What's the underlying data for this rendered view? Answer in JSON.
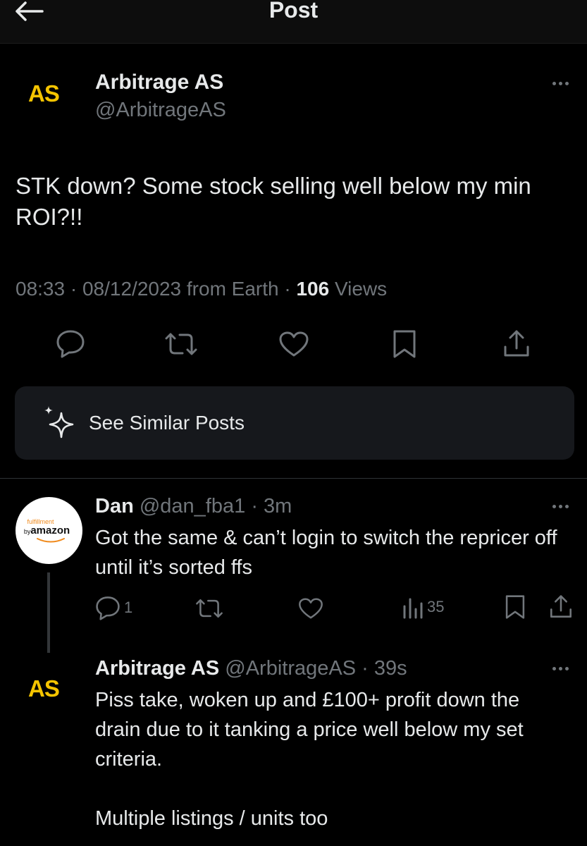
{
  "header": {
    "title": "Post"
  },
  "post": {
    "avatar_text": "AS",
    "author_name": "Arbitrage AS",
    "author_handle": "@ArbitrageAS",
    "text": "STK down? Some stock selling well below my min ROI?!!",
    "time": "08:33",
    "date": "08/12/2023",
    "source": "from Earth",
    "views_count": "106",
    "views_label": "Views"
  },
  "actions": [
    "comment-icon",
    "repost-icon",
    "like-icon",
    "bookmark-icon",
    "share-icon"
  ],
  "similar": {
    "label": "See Similar Posts",
    "icon": "sparkle-icon"
  },
  "replies": [
    {
      "avatar": {
        "small": "fulfillment",
        "prefix": "by",
        "word": "amazon"
      },
      "name": "Dan",
      "handle": "@dan_fba1",
      "time": "3m",
      "text": "Got the same & can’t login to switch the repricer off until it’s sorted ffs",
      "reply_count": "1",
      "views_count": "35"
    },
    {
      "avatar_text": "AS",
      "name": "Arbitrage AS",
      "handle": "@ArbitrageAS",
      "time": "39s",
      "text_line1": "Piss take, woken up and £100+ profit down the drain due to it tanking a price well below my set criteria.",
      "text_line2": "Multiple listings / units too"
    }
  ],
  "colors": {
    "background": "#000000",
    "accent_logo": "#f5c400",
    "muted": "#71767b",
    "text": "#e7e9ea",
    "card": "#16181c"
  }
}
